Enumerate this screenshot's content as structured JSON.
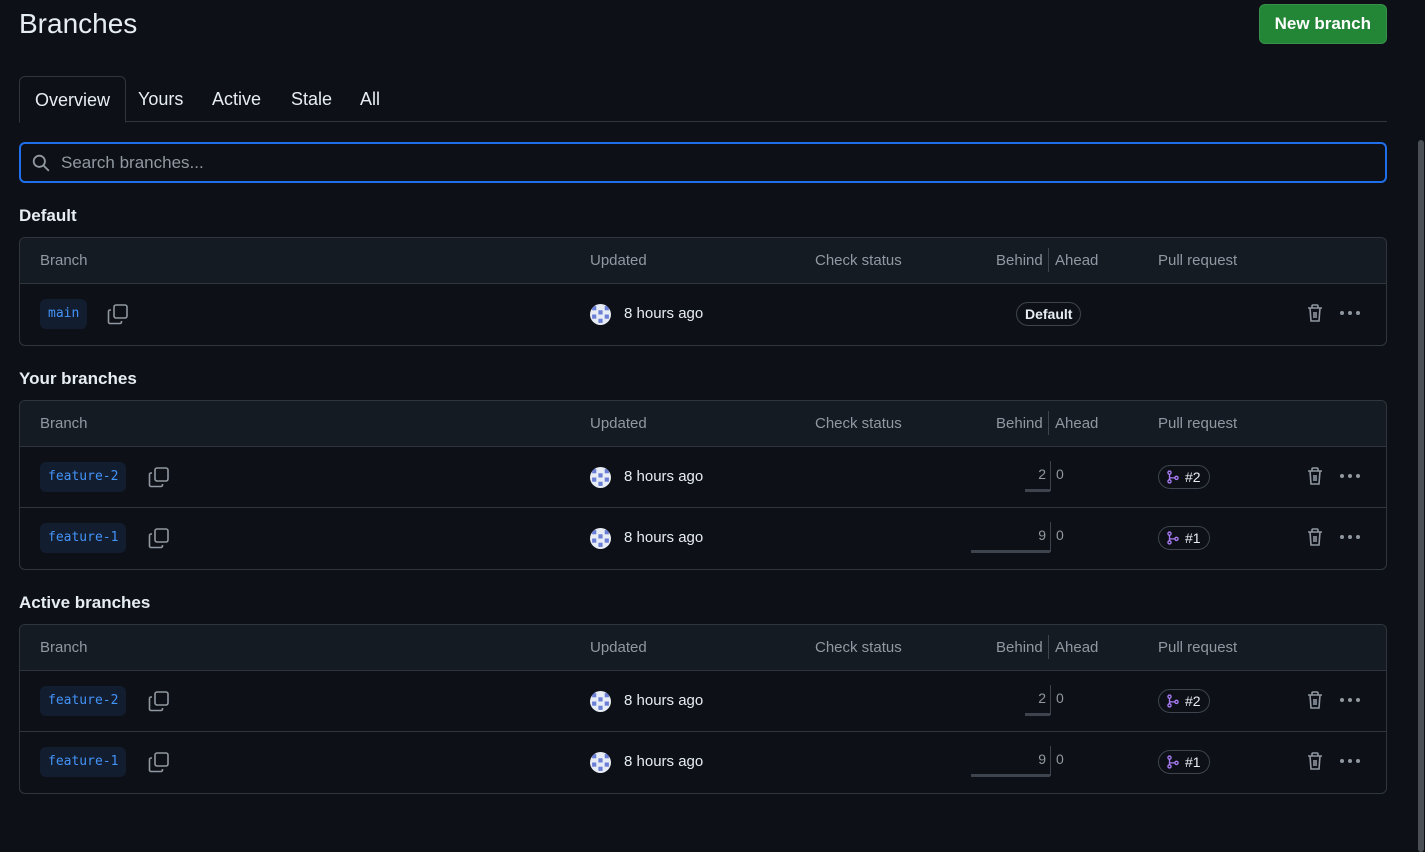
{
  "page": {
    "title": "Branches",
    "new_branch_label": "New branch"
  },
  "tabs": [
    {
      "label": "Overview",
      "selected": true
    },
    {
      "label": "Yours",
      "selected": false
    },
    {
      "label": "Active",
      "selected": false
    },
    {
      "label": "Stale",
      "selected": false
    },
    {
      "label": "All",
      "selected": false
    }
  ],
  "search": {
    "placeholder": "Search branches...",
    "value": ""
  },
  "columns": {
    "branch": "Branch",
    "updated": "Updated",
    "check_status": "Check status",
    "behind": "Behind",
    "ahead": "Ahead",
    "pull_request": "Pull request"
  },
  "sections": [
    {
      "title": "Default",
      "rows": [
        {
          "branch": "main",
          "updated": "8 hours ago",
          "badge": "Default"
        }
      ]
    },
    {
      "title": "Your branches",
      "rows": [
        {
          "branch": "feature-2",
          "updated": "8 hours ago",
          "behind": "2",
          "ahead": "0",
          "pr": "#2"
        },
        {
          "branch": "feature-1",
          "updated": "8 hours ago",
          "behind": "9",
          "ahead": "0",
          "pr": "#1"
        }
      ]
    },
    {
      "title": "Active branches",
      "rows": [
        {
          "branch": "feature-2",
          "updated": "8 hours ago",
          "behind": "2",
          "ahead": "0",
          "pr": "#2"
        },
        {
          "branch": "feature-1",
          "updated": "8 hours ago",
          "behind": "9",
          "ahead": "0",
          "pr": "#1"
        }
      ]
    }
  ],
  "colors": {
    "background": "#0d1117",
    "accent_green": "#238636",
    "link_blue": "#4493f8",
    "focus_blue": "#1f6feb",
    "pr_open_purple": "#ab7df8"
  },
  "icons": [
    "search-icon",
    "copy-icon",
    "avatar",
    "git-pull-request-icon",
    "trash-icon",
    "kebab-horizontal-icon"
  ]
}
